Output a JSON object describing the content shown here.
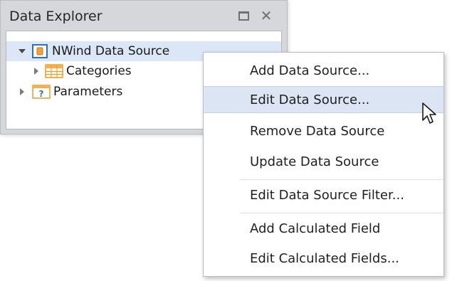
{
  "panel": {
    "title": "Data Explorer"
  },
  "tree": [
    {
      "label": "NWind Data Source",
      "icon": "data-source-icon"
    },
    {
      "label": "Categories",
      "icon": "table-icon"
    },
    {
      "label": "Parameters",
      "icon": "parameters-icon"
    }
  ],
  "menu": {
    "items": [
      {
        "label": "Add Data Source..."
      },
      {
        "label": "Edit Data Source..."
      },
      {
        "label": "Remove Data Source"
      },
      {
        "label": "Update Data Source"
      },
      {
        "label": "Edit Data Source Filter..."
      },
      {
        "label": "Add Calculated Field"
      },
      {
        "label": "Edit Calculated Fields..."
      }
    ]
  },
  "colors": {
    "panel_bg": "#d5d7db",
    "selection": "#dbe6f7",
    "menu_hover": "#dbe5f4",
    "icon_orange": "#f2a23a",
    "icon_blue": "#2e6fbf"
  }
}
